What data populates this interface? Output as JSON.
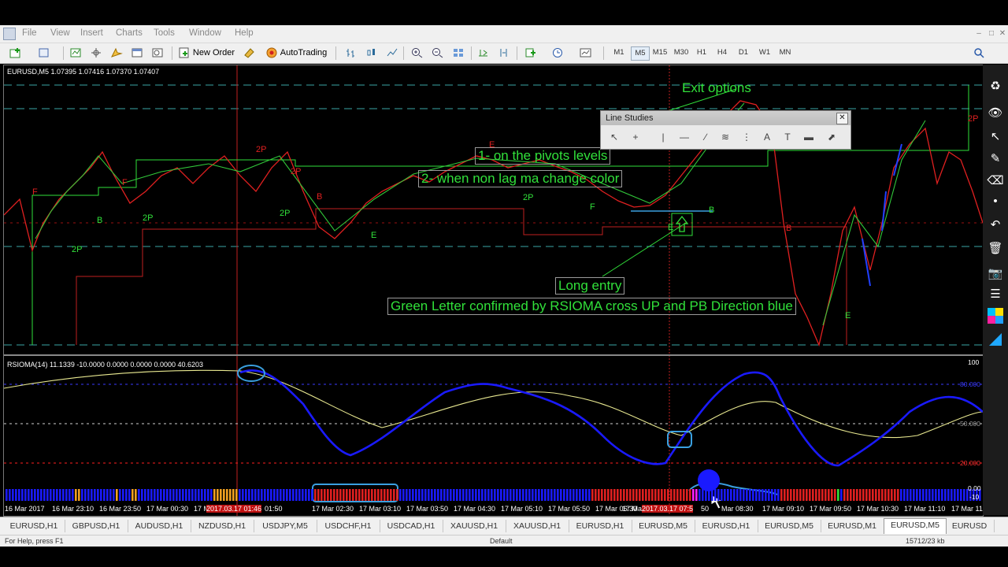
{
  "window": {
    "menu": [
      "File",
      "View",
      "Insert",
      "Charts",
      "Tools",
      "Window",
      "Help"
    ]
  },
  "toolbar": {
    "new_order": "New Order",
    "autotrading": "AutoTrading",
    "timeframes": [
      "M1",
      "M5",
      "M15",
      "M30",
      "H1",
      "H4",
      "D1",
      "W1",
      "MN"
    ],
    "selected_timeframe": "M5"
  },
  "chart": {
    "header": "EURUSD,M5  1.07395 1.07416 1.07370 1.07407",
    "pivot_letters": [
      {
        "text": "2P",
        "color": "#e02020"
      },
      {
        "text": "F",
        "color": "#e02020"
      },
      {
        "text": "B",
        "color": "#31e03a"
      },
      {
        "text": "2P",
        "color": "#31e03a"
      },
      {
        "text": "2P",
        "color": "#31e03a"
      },
      {
        "text": "F",
        "color": "#e02020"
      },
      {
        "text": "2P",
        "color": "#e02020"
      },
      {
        "text": "2P",
        "color": "#31e03a"
      },
      {
        "text": "B",
        "color": "#e02020"
      },
      {
        "text": "E",
        "color": "#31e03a"
      },
      {
        "text": "E",
        "color": "#e02020"
      },
      {
        "text": "2P",
        "color": "#31e03a"
      },
      {
        "text": "F",
        "color": "#31e03a"
      },
      {
        "text": "B",
        "color": "#31e03a"
      },
      {
        "text": "E",
        "color": "#31e03a"
      },
      {
        "text": "B",
        "color": "#e02020"
      },
      {
        "text": "2P",
        "color": "#e02020"
      },
      {
        "text": "E",
        "color": "#31e03a"
      }
    ]
  },
  "annotations": {
    "exit": "Exit options",
    "pivots": "1- on the pivots levels",
    "nonlag": "2- when non lag ma change color",
    "long": "Long entry",
    "confirm": "Green Letter confirmed by RSIOMA cross UP and PB Direction blue"
  },
  "line_studies": {
    "title": "Line Studies",
    "tools": [
      "cursor-icon",
      "crosshair-icon",
      "vertical-line-icon",
      "horizontal-line-icon",
      "trendline-icon",
      "fibonacci-icon",
      "channel-icon",
      "text-icon",
      "label-icon",
      "arrows-icon"
    ]
  },
  "indicator": {
    "title": "RSIOMA(14) 11.1339 -10.0000 0.0000 0.0000 0.0000 40.6203",
    "scale": [
      "100",
      "80.000",
      "50.000",
      "20.000",
      "0.00",
      "-10"
    ]
  },
  "time_axis": [
    "16 Mar 2017",
    "16 Mar 23:10",
    "16 Mar 23:50",
    "17 Mar 00:30",
    "17 Mar 01:10",
    "2017.03.17 01:46",
    "01:50",
    "17 Mar 02:30",
    "17 Mar 03:10",
    "17 Mar 03:50",
    "17 Mar 04:30",
    "17 Mar 05:10",
    "17 Mar 05:50",
    "17 Mar 06:30",
    "17 Ma",
    "2017.03.17 07:5",
    "50",
    "Mar 08:30",
    "17 Mar 09:10",
    "17 Mar 09:50",
    "17 Mar 10:30",
    "17 Mar 11:10",
    "17 Mar 11:50"
  ],
  "tabs": [
    "EURUSD,H1",
    "GBPUSD,H1",
    "AUDUSD,H1",
    "NZDUSD,H1",
    "USDJPY,M5",
    "USDCHF,H1",
    "USDCAD,H1",
    "XAUUSD,H1",
    "XAUUSD,H1",
    "EURUSD,H1",
    "EURUSD,M5",
    "EURUSD,H1",
    "EURUSD,M5",
    "EURUSD,M1",
    "EURUSD,M5",
    "EURUSD"
  ],
  "active_tab": 14,
  "status": {
    "help": "For Help, press F1",
    "profile": "Default",
    "traffic": "15712/23 kb"
  },
  "colors": {
    "bull": "#31e03a",
    "bear": "#e02020",
    "indicator_blue": "#1a1aff",
    "signal_yellow": "#e8e890",
    "highlight": "#3aa0e0"
  }
}
